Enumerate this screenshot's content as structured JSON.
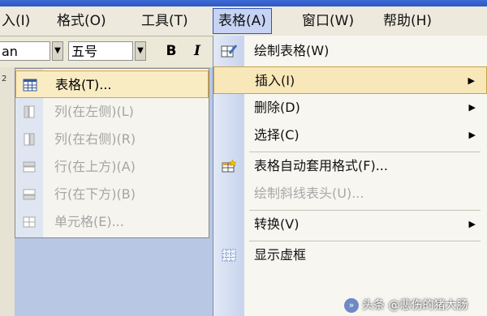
{
  "menubar": {
    "items": [
      {
        "label": "入(I)"
      },
      {
        "label": "格式(O)"
      },
      {
        "label": "工具(T)"
      },
      {
        "label": "表格(A)"
      },
      {
        "label": "窗口(W)"
      },
      {
        "label": "帮助(H)"
      }
    ]
  },
  "toolbar": {
    "font_name": "an",
    "font_size": "五号",
    "bold_label": "B",
    "italic_label": "I"
  },
  "ruler": {
    "mark": "2"
  },
  "insert_submenu": {
    "items": [
      {
        "label": "表格(T)...",
        "icon": "table-icon",
        "enabled": true
      },
      {
        "label": "列(在左侧)(L)",
        "icon": "column-left-icon",
        "enabled": false
      },
      {
        "label": "列(在右侧)(R)",
        "icon": "column-right-icon",
        "enabled": false
      },
      {
        "label": "行(在上方)(A)",
        "icon": "row-above-icon",
        "enabled": false
      },
      {
        "label": "行(在下方)(B)",
        "icon": "row-below-icon",
        "enabled": false
      },
      {
        "label": "单元格(E)...",
        "icon": "cells-icon",
        "enabled": false
      }
    ]
  },
  "table_menu": {
    "items": [
      {
        "label": "绘制表格(W)",
        "icon": "pencil-table-icon",
        "enabled": true,
        "submenu": false
      },
      {
        "label": "插入(I)",
        "icon": "",
        "enabled": true,
        "submenu": true
      },
      {
        "label": "删除(D)",
        "icon": "",
        "enabled": true,
        "submenu": true
      },
      {
        "label": "选择(C)",
        "icon": "",
        "enabled": true,
        "submenu": true
      },
      {
        "label": "表格自动套用格式(F)...",
        "icon": "autoformat-icon",
        "enabled": true,
        "submenu": false
      },
      {
        "label": "绘制斜线表头(U)...",
        "icon": "",
        "enabled": false,
        "submenu": false
      },
      {
        "label": "转换(V)",
        "icon": "",
        "enabled": true,
        "submenu": true
      },
      {
        "label": "显示虚框",
        "icon": "gridlines-icon",
        "enabled": true,
        "submenu": false
      }
    ],
    "arrow_glyph": "▶",
    "expand_glyph": "»"
  },
  "watermark": "头条 @悲伤的猪大肠",
  "colors": {
    "menubar": "#ede9dc",
    "highlight": "#f8e7b9",
    "highlight_border": "#c9a24a",
    "active_menu": "#c6d3f4",
    "disabled_text": "#a8a8a8"
  }
}
